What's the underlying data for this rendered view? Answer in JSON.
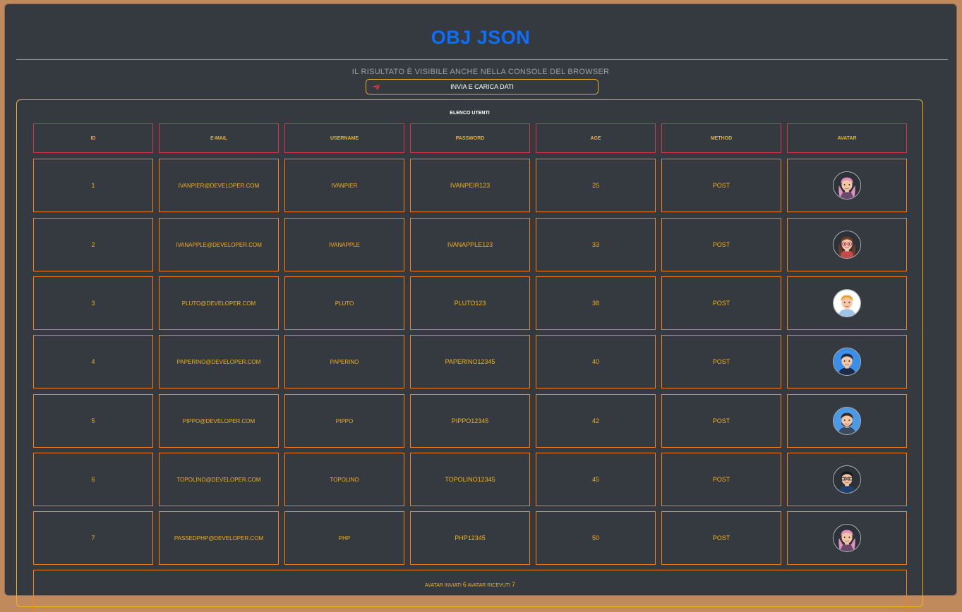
{
  "page": {
    "title": "OBJ JSON",
    "subtitle": "Il risultato è visibile anche nella console del browser",
    "send_button": "Invia e carica dati"
  },
  "table": {
    "caption": "Elenco utenti",
    "headers": [
      "ID",
      "E-MAIL",
      "USERNAME",
      "PASSWORD",
      "AGE",
      "METHOD",
      "AVATAR"
    ],
    "rows": [
      {
        "id": "1",
        "email": "ivanpier@developer.com",
        "username": "ivanpier",
        "password": "ivanpeir123",
        "age": "25",
        "method": "POST",
        "avatar": "woman-pink-hair-avatar"
      },
      {
        "id": "2",
        "email": "ivanapple@developer.com",
        "username": "ivanapple",
        "password": "ivanapple123",
        "age": "33",
        "method": "POST",
        "avatar": "woman-glasses-avatar"
      },
      {
        "id": "3",
        "email": "pluto@developer.com",
        "username": "pluto",
        "password": "pluto123",
        "age": "38",
        "method": "POST",
        "avatar": "blond-boy-avatar"
      },
      {
        "id": "4",
        "email": "paperino@developer.com",
        "username": "paperino",
        "password": "paperino12345",
        "age": "40",
        "method": "POST",
        "avatar": "man-blue-bg-avatar"
      },
      {
        "id": "5",
        "email": "pippo@developer.com",
        "username": "pippo",
        "password": "pippo12345",
        "age": "42",
        "method": "POST",
        "avatar": "bearded-man-avatar"
      },
      {
        "id": "6",
        "email": "topolino@developer.com",
        "username": "topolino",
        "password": "topolino12345",
        "age": "45",
        "method": "POST",
        "avatar": "man-glasses-avatar"
      },
      {
        "id": "7",
        "email": "passedphp@developer.com",
        "username": "php",
        "password": "php12345",
        "age": "50",
        "method": "POST",
        "avatar": "woman-pink-hair-avatar"
      }
    ]
  },
  "footer": {
    "sent_label": "avatar inviati",
    "sent_count": "6",
    "received_label": "avatar ricevuti",
    "received_count": "7"
  },
  "colors": {
    "background": "#343a40",
    "title": "#0d6efd",
    "accent": "#f0b020",
    "header_border": "#dc3545",
    "cell_border": "#fd7e14"
  }
}
